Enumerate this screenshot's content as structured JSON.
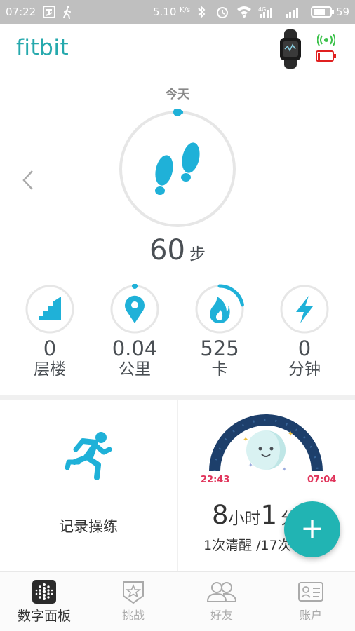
{
  "status_bar": {
    "time": "07:22",
    "network_speed": "5.10",
    "network_speed_unit": "K/s",
    "network_type": "4G",
    "battery_level": "59"
  },
  "header": {
    "brand": "fitbit",
    "device_battery_level": 0.15
  },
  "steps": {
    "day_label": "今天",
    "value": "60",
    "unit": "步",
    "progress": 0.01
  },
  "stats": [
    {
      "id": "floors",
      "value": "0",
      "label": "层楼",
      "icon": "stairs-icon",
      "progress": 0
    },
    {
      "id": "distance",
      "value": "0.04",
      "label": "公里",
      "icon": "location-pin-icon",
      "progress": 0.01
    },
    {
      "id": "calories",
      "value": "525",
      "label": "卡",
      "icon": "flame-icon",
      "progress": 0.22
    },
    {
      "id": "active_minutes",
      "value": "0",
      "label": "分钟",
      "icon": "lightning-icon",
      "progress": 0
    }
  ],
  "cards": {
    "workout_label": "记录操练",
    "sleep": {
      "start_time": "22:43",
      "end_time": "07:04",
      "hours": "8",
      "hours_unit": "小时",
      "minutes": "1",
      "minutes_unit": "分",
      "detail": "1次清醒 /17次"
    }
  },
  "fab_label": "+",
  "nav": [
    {
      "label": "数字面板",
      "icon": "dashboard-icon",
      "active": true
    },
    {
      "label": "挑战",
      "icon": "star-badge-icon",
      "active": false
    },
    {
      "label": "好友",
      "icon": "friends-icon",
      "active": false
    },
    {
      "label": "账户",
      "icon": "account-card-icon",
      "active": false
    }
  ],
  "colors": {
    "accent": "#26a9ad",
    "icon_blue": "#1fb1d8",
    "sleep_dark": "#1d3f6b",
    "sleep_time": "#e0335a",
    "fab": "#21b4b3",
    "status_bar": "#bfbfbf"
  }
}
